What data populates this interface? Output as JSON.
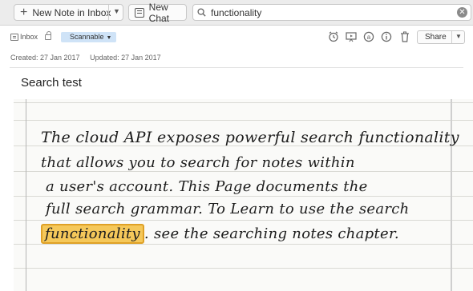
{
  "toolbar": {
    "new_note_label": "New Note in Inbox",
    "new_chat_label": "New Chat",
    "search_value": "functionality"
  },
  "note": {
    "notebook": "Inbox",
    "tag": "Scannable",
    "share_label": "Share",
    "created": "Created: 27 Jan 2017",
    "updated": "Updated: 27 Jan 2017",
    "title": "Search test"
  },
  "handwriting": {
    "line1": "The cloud API exposes powerful search functionality",
    "line2": "that allows you to search for notes within",
    "line3": "a user's account. This Page documents the",
    "line4": "full search grammar. To Learn to use the search",
    "line5_highlight": "functionality",
    "line5_rest": ". see the searching notes chapter."
  },
  "colors": {
    "highlight": "#f5c85a",
    "tag_bg": "#cfe3f7",
    "toolbar_bg": "#ececec"
  },
  "icons": [
    "plus-icon",
    "chevron-down-icon",
    "chat-icon",
    "search-icon",
    "clear-icon",
    "notebook-icon",
    "lock-icon",
    "reminder-icon",
    "presentation-icon",
    "mention-icon",
    "info-icon",
    "trash-icon"
  ]
}
